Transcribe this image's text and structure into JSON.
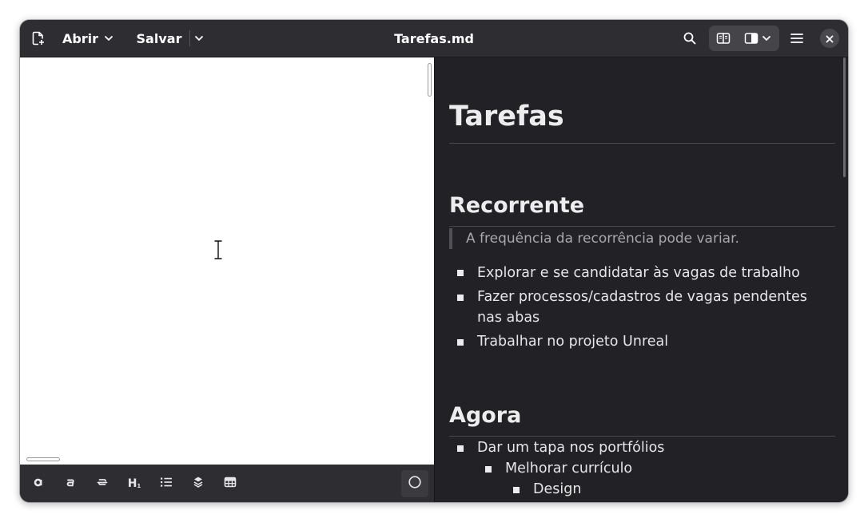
{
  "headerbar": {
    "open_label": "Abrir",
    "save_label": "Salvar",
    "title": "Tarefas.md"
  },
  "preview": {
    "h1": "Tarefas",
    "sections": [
      {
        "heading": "Recorrente",
        "quote": "A frequência da recorrência pode variar.",
        "items": [
          "Explorar e se candidatar às vagas de trabalho",
          "Fazer processos/cadastros de vagas pendentes",
          "nas abas",
          "Trabalhar no projeto Unreal"
        ]
      },
      {
        "heading": "Agora",
        "items": [
          "Dar um tapa nos portfólios",
          "Melhorar currículo",
          "Design"
        ]
      }
    ]
  },
  "toolbar": {
    "heading_label": "H",
    "heading_sub": "1"
  },
  "icons": [
    "new-document-icon",
    "chevron-down-icon",
    "search-icon",
    "split-view-icon",
    "sidebar-view-icon",
    "menu-icon",
    "close-icon",
    "bold-icon",
    "italic-icon",
    "strikethrough-icon",
    "heading-icon",
    "list-icon",
    "code-icon",
    "table-icon",
    "circle-icon"
  ],
  "colors": {
    "headerbar_bg": "#2e2e32",
    "preview_bg": "#222226",
    "editor_bg": "#ffffff",
    "text_primary": "#e6e6e6",
    "quote_text": "#a8a8ad"
  }
}
